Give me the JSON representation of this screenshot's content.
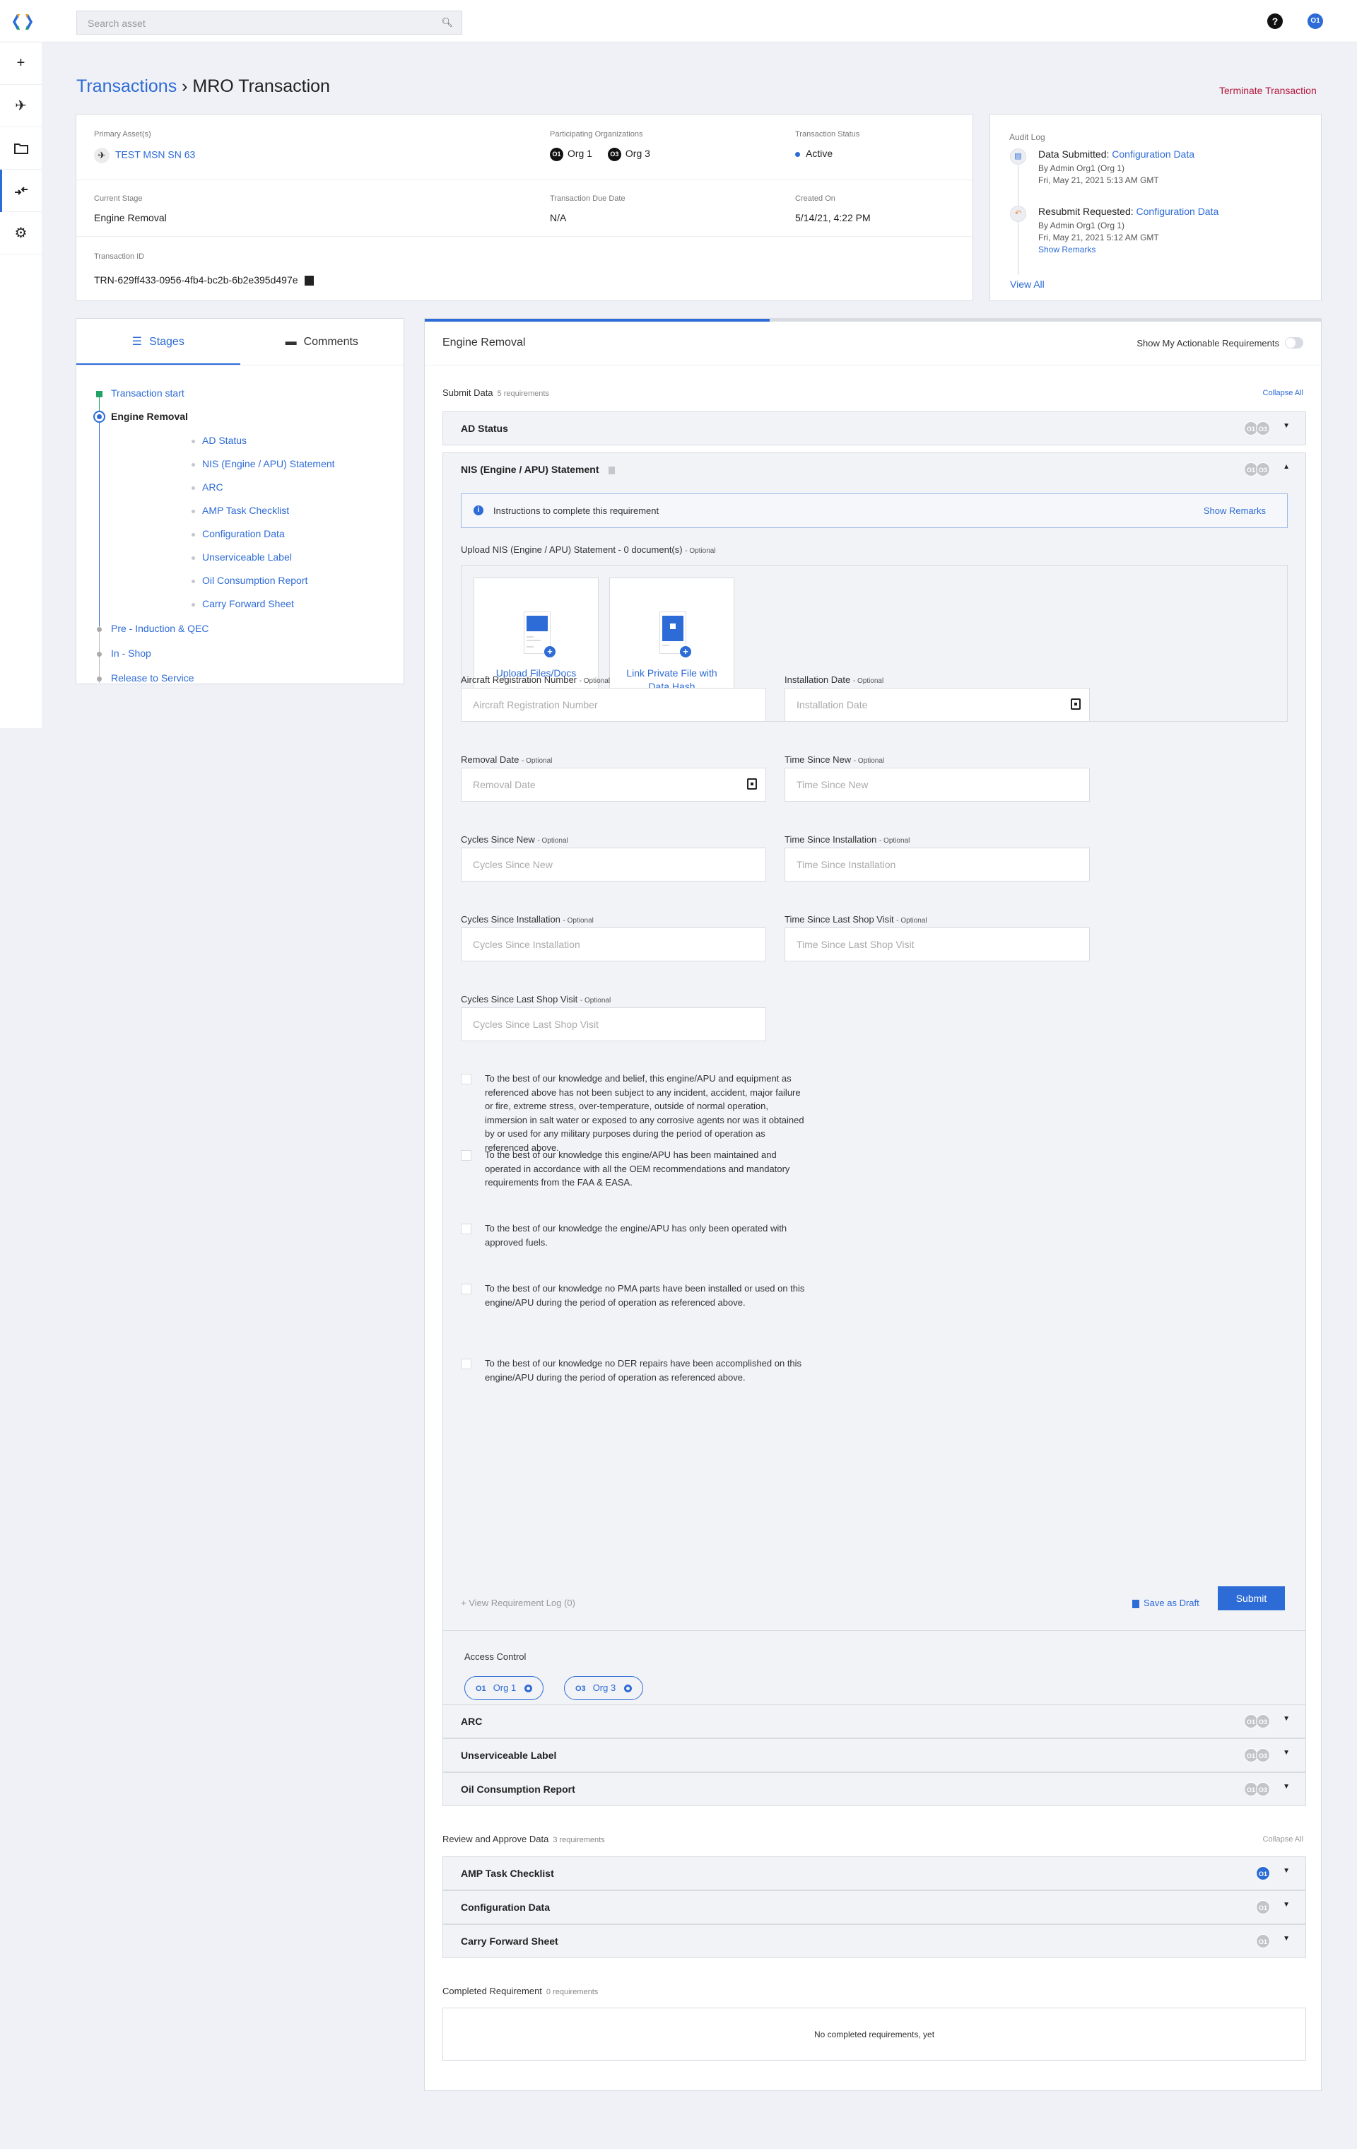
{
  "topbar": {
    "search_placeholder": "Search asset",
    "help_label": "?",
    "user_initials": "O1"
  },
  "sidenav": [
    "add-icon",
    "aircraft-icon",
    "folder-icon",
    "transactions-icon",
    "settings-icon"
  ],
  "breadcrumb": {
    "parent": "Transactions",
    "separator": "›",
    "current": "MRO Transaction"
  },
  "terminate_label": "Terminate Transaction",
  "info": {
    "primary_assets_label": "Primary Asset(s)",
    "primary_asset": "TEST MSN SN 63",
    "participating_label": "Participating Organizations",
    "orgs": [
      {
        "badge": "O1",
        "name": "Org 1"
      },
      {
        "badge": "O3",
        "name": "Org 3"
      }
    ],
    "status_label": "Transaction Status",
    "status": "Active",
    "current_stage_label": "Current Stage",
    "current_stage": "Engine Removal",
    "due_label": "Transaction Due Date",
    "due": "N/A",
    "created_label": "Created On",
    "created": "5/14/21, 4:22 PM",
    "id_label": "Transaction ID",
    "id": "TRN-629ff433-0956-4fb4-bc2b-6b2e395d497e"
  },
  "audit": {
    "title": "Audit Log",
    "items": [
      {
        "action": "Data Submitted:",
        "target": "Configuration Data",
        "by": "By Admin Org1 (Org 1)",
        "time": "Fri, May 21, 2021 5:13 AM GMT"
      },
      {
        "action": "Resubmit Requested:",
        "target": "Configuration Data",
        "by": "By Admin Org1 (Org 1)",
        "time": "Fri, May 21, 2021 5:12 AM GMT",
        "extra": "Show Remarks"
      }
    ],
    "view_all": "View All"
  },
  "stages_panel": {
    "tabs": [
      "Stages",
      "Comments"
    ],
    "stages": [
      {
        "label": "Transaction start"
      },
      {
        "label": "Engine Removal",
        "current": true,
        "subs": [
          "AD Status",
          "NIS (Engine / APU) Statement",
          "ARC",
          "AMP Task Checklist",
          "Configuration Data",
          "Unserviceable Label",
          "Oil Consumption Report",
          "Carry Forward Sheet"
        ]
      },
      {
        "label": "Pre - Induction & QEC"
      },
      {
        "label": "In - Shop"
      },
      {
        "label": "Release to Service"
      }
    ]
  },
  "main": {
    "stage_title": "Engine Removal",
    "stage_progress_percent": 38.5,
    "toggle_label": "Show My Actionable Requirements",
    "toggle_on": false,
    "submit_section": {
      "title": "Submit Data",
      "count": "5 requirements",
      "collapse": "Collapse All"
    },
    "requirements": [
      {
        "name": "AD Status",
        "orgs": [
          "O1",
          "O3"
        ]
      },
      {
        "name": "NIS (Engine / APU) Statement",
        "orgs": [
          "O1",
          "O3"
        ],
        "expanded": true
      },
      {
        "name": "ARC",
        "orgs": [
          "O1",
          "O3"
        ]
      },
      {
        "name": "Unserviceable Label",
        "orgs": [
          "O1",
          "O3"
        ]
      },
      {
        "name": "Oil Consumption Report",
        "orgs": [
          "O1",
          "O3"
        ]
      }
    ],
    "nis": {
      "instructions": "Instructions to complete this requirement",
      "show_remarks": "Show Remarks",
      "upload_label": "Upload NIS (Engine / APU) Statement - 0 document(s)",
      "optional": "- Optional",
      "upload_files": "Upload Files/Docs",
      "link_private": "Link Private File with Data Hash",
      "fields": [
        {
          "label": "Aircraft Registration Number",
          "placeholder": "Aircraft Registration Number"
        },
        {
          "label": "Installation Date",
          "placeholder": "Installation Date",
          "calendar": true
        },
        {
          "label": "Removal Date",
          "placeholder": "Removal Date",
          "calendar": true
        },
        {
          "label": "Time Since New",
          "placeholder": "Time Since New"
        },
        {
          "label": "Cycles Since New",
          "placeholder": "Cycles Since New"
        },
        {
          "label": "Time Since Installation",
          "placeholder": "Time Since Installation"
        },
        {
          "label": "Cycles Since Installation",
          "placeholder": "Cycles Since Installation"
        },
        {
          "label": "Time Since Last Shop Visit",
          "placeholder": "Time Since Last Shop Visit"
        },
        {
          "label": "Cycles Since Last Shop Visit",
          "placeholder": "Cycles Since Last Shop Visit"
        }
      ],
      "statements": [
        "To the best of our knowledge and belief, this engine/APU and equipment as referenced above has not been subject to any incident, accident, major failure or fire, extreme stress, over-temperature, outside of normal operation, immersion in salt water or exposed to any corrosive agents nor was it obtained by or used for any military purposes during the period of operation as referenced above.",
        "To the best of our knowledge this engine/APU has been maintained and operated in accordance with all the OEM recommendations and mandatory requirements from the FAA & EASA.",
        "To the best of our knowledge the engine/APU has only been operated with approved fuels.",
        "To the best of our knowledge no PMA parts have been installed or used on this engine/APU during the period of operation as referenced above.",
        "To the best of our knowledge no DER repairs have been accomplished on this engine/APU during the period of operation as referenced above."
      ],
      "view_log": "+ View Requirement Log (0)",
      "save_draft": "Save as Draft",
      "submit": "Submit",
      "access_control": "Access Control",
      "access_orgs": [
        {
          "badge": "O1",
          "name": "Org 1"
        },
        {
          "badge": "O3",
          "name": "Org 3"
        }
      ]
    },
    "review_section": {
      "title": "Review and Approve Data",
      "count": "3 requirements",
      "collapse": "Collapse All"
    },
    "review_requirements": [
      {
        "name": "AMP Task Checklist",
        "orgs": [
          "O1"
        ],
        "active": true
      },
      {
        "name": "Configuration Data",
        "orgs": [
          "O1"
        ]
      },
      {
        "name": "Carry Forward Sheet",
        "orgs": [
          "O1"
        ]
      }
    ],
    "completed_section": {
      "title": "Completed Requirement",
      "count": "0 requirements"
    },
    "completed_empty": "No completed requirements, yet"
  }
}
